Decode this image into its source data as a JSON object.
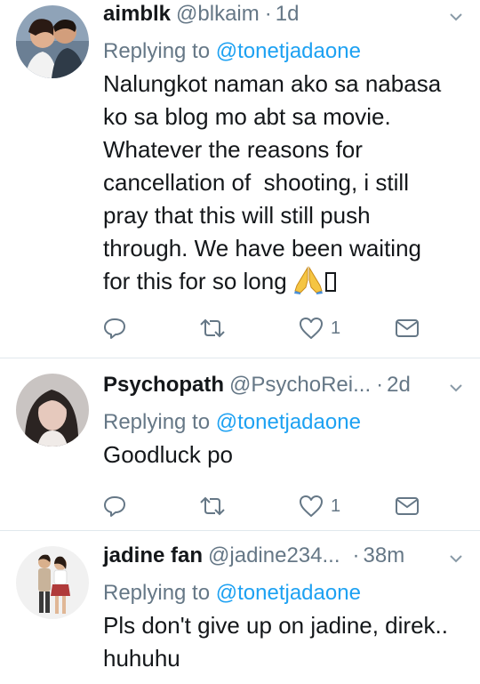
{
  "tweets": [
    {
      "name": "aimblk",
      "handle": "@blkaim",
      "separator": "·",
      "time": "1d",
      "reply_prefix": "Replying to",
      "reply_to": "@tonetjadaone",
      "text": "Nalungkot naman ako sa nabasa\nko sa blog mo abt sa movie.\nWhatever the reasons for\ncancellation of  shooting, i still\npray that this will still push\nthrough. We have been waiting\nfor this for so long",
      "like_count": "1"
    },
    {
      "name": "Psychopath",
      "handle": "@PsychoRei...",
      "separator": "·",
      "time": "2d",
      "reply_prefix": "Replying to",
      "reply_to": "@tonetjadaone",
      "text": "Goodluck po",
      "like_count": "1"
    },
    {
      "name": "jadine fan",
      "handle": "@jadine234...",
      "separator": "·",
      "time": "38m",
      "reply_prefix": "Replying to",
      "reply_to": "@tonetjadaone",
      "text": "Pls don't give up on jadine, direk..\nhuhuhu"
    }
  ],
  "icons": {
    "reply": "reply-icon",
    "retweet": "retweet-icon",
    "like": "heart-icon",
    "dm": "envelope-icon",
    "caret": "chevron-down-icon",
    "emoji": "folded-hands-emoji"
  },
  "colors": {
    "text": "#14171a",
    "secondary": "#657786",
    "link": "#1da1f2",
    "divider": "#e1e8ed"
  }
}
